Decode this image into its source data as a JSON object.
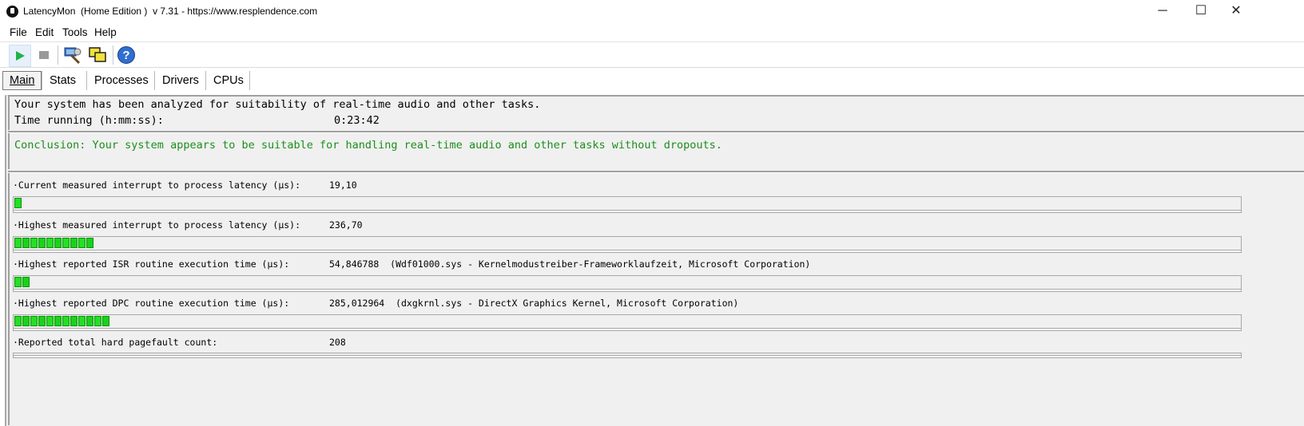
{
  "window": {
    "title": "LatencyMon  (Home Edition )  v 7.31 - https://www.resplendence.com",
    "minimize_glyph": "─",
    "maximize_glyph": "☐",
    "close_glyph": "✕"
  },
  "menu": {
    "file": "File",
    "edit": "Edit",
    "tools": "Tools",
    "help": "Help"
  },
  "toolbar": {
    "icons": [
      "play-icon",
      "stop-icon",
      "driver-analyze-icon",
      "windows-icon",
      "help-icon"
    ]
  },
  "tabs": [
    "Main",
    "Stats",
    "Processes",
    "Drivers",
    "CPUs"
  ],
  "summary": {
    "analyzed_text": "Your system has been analyzed for suitability of real-time audio and other tasks.",
    "time_label": "Time running (h:mm:ss):",
    "time_value": "0:23:42"
  },
  "conclusion": {
    "text": "Conclusion: Your system appears to be suitable for handling real-time audio and other tasks without dropouts.",
    "color": "#1b8f1b"
  },
  "metrics": [
    {
      "label": "·Current measured interrupt to process latency (µs):",
      "value": "19,10",
      "bar_segments": 1
    },
    {
      "label": "·Highest measured interrupt to process latency (µs):",
      "value": "236,70",
      "bar_segments": 10
    },
    {
      "label": "·Highest reported ISR routine execution time (µs):",
      "value": "54,846788  (Wdf01000.sys - Kernelmodustreiber-Frameworklaufzeit, Microsoft Corporation)",
      "bar_segments": 2
    },
    {
      "label": "·Highest reported DPC routine execution time (µs):",
      "value": "285,012964  (dxgkrnl.sys - DirectX Graphics Kernel, Microsoft Corporation)",
      "bar_segments": 12
    },
    {
      "label": "·Reported total hard pagefault count:",
      "value": "208",
      "bar_segments": 0
    }
  ],
  "colors": {
    "bar_green": "#22e022",
    "bar_border": "#0c8f0c"
  }
}
